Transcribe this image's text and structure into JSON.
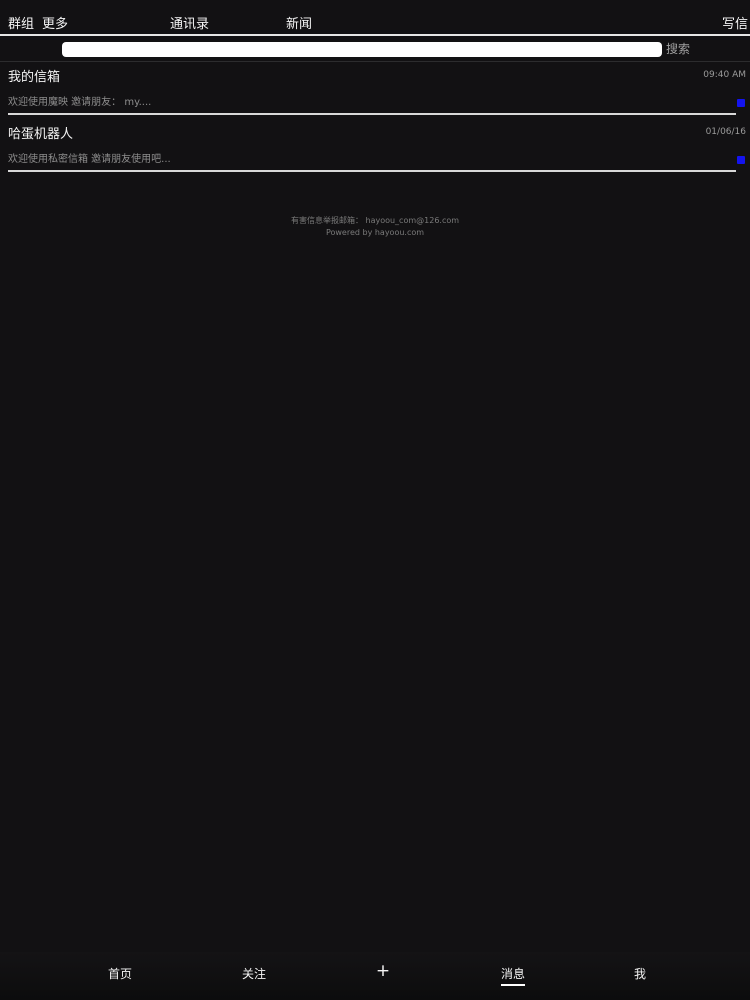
{
  "topnav": {
    "groups_label": "群组",
    "more_label": "更多",
    "contacts_label": "通讯录",
    "news_label": "新闻",
    "compose_label": "写信"
  },
  "search": {
    "value": "",
    "placeholder": "",
    "button_label": "搜索"
  },
  "messages": [
    {
      "title": "我的信箱",
      "time": "09:40 AM",
      "preview": "欢迎使用魔映 邀请朋友：  my....",
      "unread": true
    },
    {
      "title": "哈蛋机器人",
      "time": "01/06/16",
      "preview": "欢迎使用私密信箱 邀请朋友使用吧...",
      "unread": true
    }
  ],
  "footer": {
    "report_line": "有害信息举报邮箱：  hayoou_com@126.com",
    "powered_line": "Powered by hayoou.com"
  },
  "tabbar": {
    "tabs": [
      {
        "label": "首页"
      },
      {
        "label": "关注"
      },
      {
        "label": "+"
      },
      {
        "label": "消息"
      },
      {
        "label": "我"
      }
    ],
    "active_index": 3
  },
  "colors": {
    "background": "#121113",
    "unread_dot": "#1414f0",
    "divider": "#d8d8d8"
  }
}
